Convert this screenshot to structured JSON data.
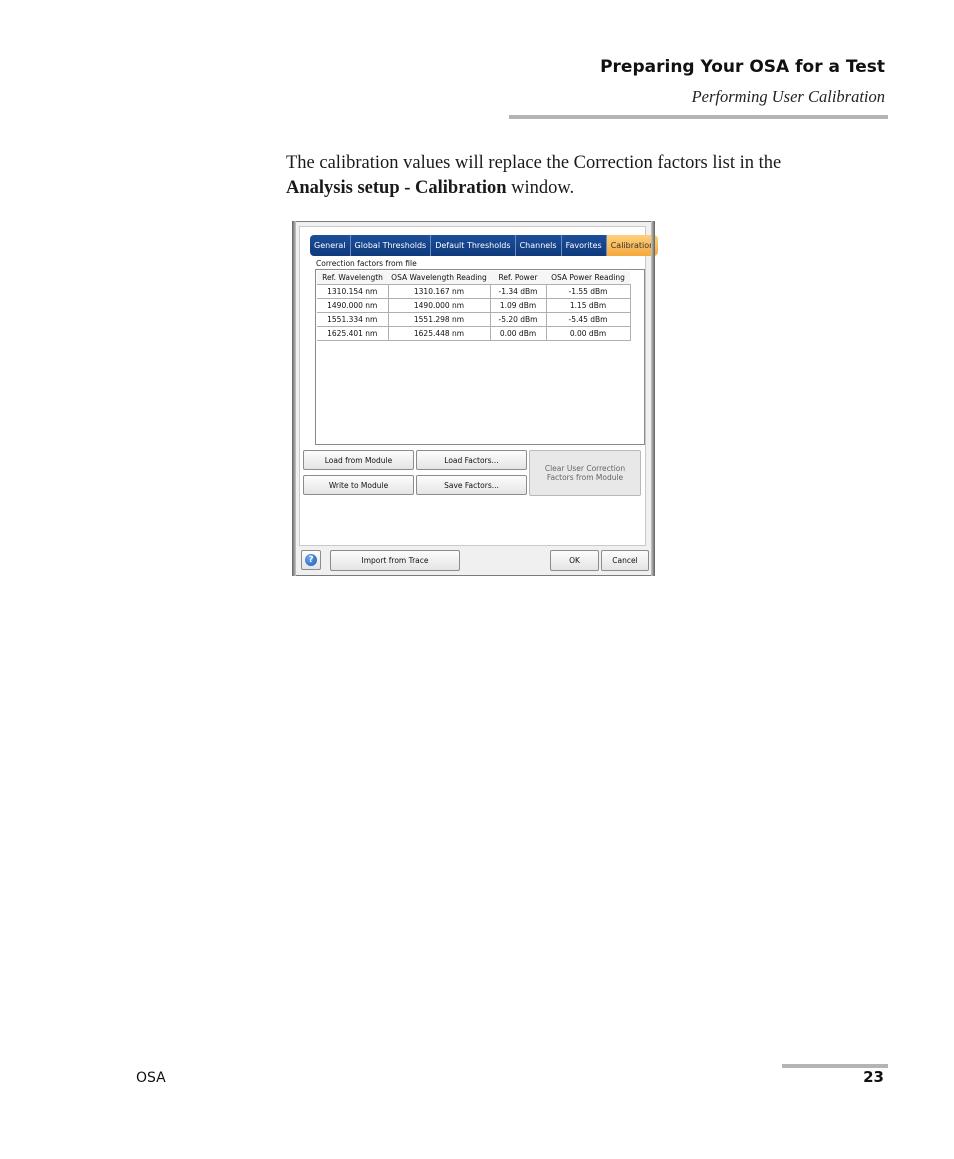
{
  "header": {
    "title": "Preparing Your OSA for a Test",
    "subtitle": "Performing User Calibration"
  },
  "body": {
    "line1": "The calibration values will replace the Correction factors list in the",
    "line2_bold": "Analysis setup - Calibration",
    "line2_rest": " window."
  },
  "dialog": {
    "tabs": [
      "General",
      "Global Thresholds",
      "Default Thresholds",
      "Channels",
      "Favorites",
      "Calibration"
    ],
    "active_tab": "Calibration",
    "group_label": "Correction factors from file",
    "columns": [
      "Ref. Wavelength",
      "OSA Wavelength Reading",
      "Ref. Power",
      "OSA Power Reading"
    ],
    "rows": [
      [
        "1310.154 nm",
        "1310.167 nm",
        "-1.34 dBm",
        "-1.55 dBm"
      ],
      [
        "1490.000 nm",
        "1490.000 nm",
        "1.09 dBm",
        "1.15 dBm"
      ],
      [
        "1551.334 nm",
        "1551.298 nm",
        "-5.20 dBm",
        "-5.45 dBm"
      ],
      [
        "1625.401 nm",
        "1625.448 nm",
        "0.00 dBm",
        "0.00 dBm"
      ]
    ],
    "buttons": {
      "load_from_module": "Load from Module",
      "load_factors": "Load Factors...",
      "write_to_module": "Write to Module",
      "save_factors": "Save Factors...",
      "clear_user": "Clear User Correction Factors from Module",
      "import_from_trace": "Import from Trace",
      "ok": "OK",
      "cancel": "Cancel"
    },
    "help_icon": "help-icon",
    "accent_color": "#f4a93e",
    "tab_color": "#1d4f9a"
  },
  "footer": {
    "left": "OSA",
    "page": "23"
  }
}
